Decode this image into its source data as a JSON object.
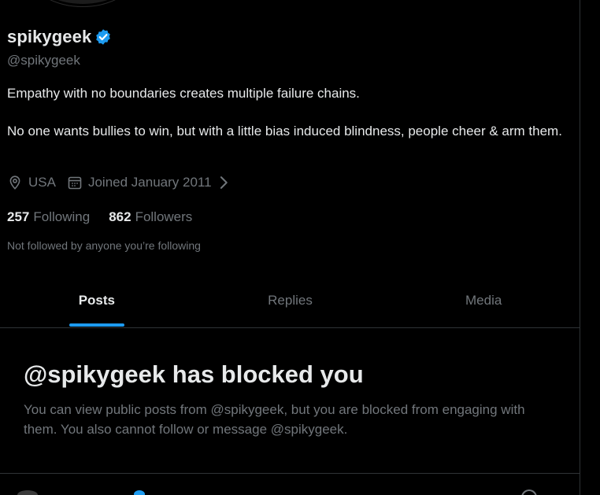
{
  "profile": {
    "display_name": "spikygeek",
    "handle": "@spikygeek",
    "bio": [
      "Empathy with no boundaries creates multiple failure chains.",
      "No one wants bullies to win, but with a little bias induced blindness, people cheer & arm them."
    ],
    "location": "USA",
    "joined": "Joined January 2011",
    "following_count": "257",
    "following_label": "Following",
    "followers_count": "862",
    "followers_label": "Followers",
    "not_followed_text": "Not followed by anyone you’re following"
  },
  "tabs": [
    {
      "label": "Posts",
      "active": true
    },
    {
      "label": "Replies",
      "active": false
    },
    {
      "label": "Media",
      "active": false
    }
  ],
  "blocked": {
    "title": "@spikygeek has blocked you",
    "description": "You can view public posts from @spikygeek, but you are blocked from engaging with them. You also cannot follow or message @spikygeek."
  },
  "icons": {
    "verified": "verified-badge-icon",
    "location": "location-pin-icon",
    "joined": "calendar-icon",
    "chevron": "chevron-right-icon"
  },
  "colors": {
    "background": "#000000",
    "text_primary": "#e7e9ea",
    "text_secondary": "#71767b",
    "accent": "#1d9bf0",
    "border": "#2f3336"
  }
}
